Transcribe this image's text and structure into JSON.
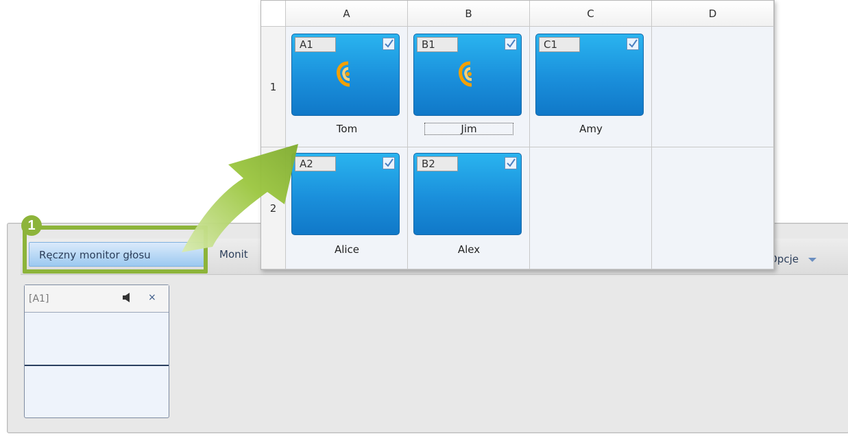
{
  "tabs": {
    "active_label": "Ręczny monitor głosu",
    "monitor_label": "Monit",
    "options_label": "Opcje"
  },
  "callout": {
    "number": "1"
  },
  "small_card": {
    "label": "[A1]"
  },
  "grid": {
    "columns": [
      "A",
      "B",
      "C",
      "D"
    ],
    "rows": [
      "1",
      "2"
    ],
    "tiles": [
      {
        "code": "A1",
        "name": "Tom",
        "ear": true
      },
      {
        "code": "B1",
        "name": "Jim",
        "ear": true
      },
      {
        "code": "C1",
        "name": "Amy",
        "ear": false
      },
      {
        "code": "A2",
        "name": "Alice",
        "ear": false
      },
      {
        "code": "B2",
        "name": "Alex",
        "ear": false
      }
    ]
  },
  "colors": {
    "accent_green": "#8db43a",
    "tile_blue": "#1a8fdb",
    "ear_orange": "#f4a000"
  },
  "icons": [
    "speaker-icon",
    "close-icon",
    "ear-icon",
    "checkbox-icon",
    "arrow-icon"
  ]
}
